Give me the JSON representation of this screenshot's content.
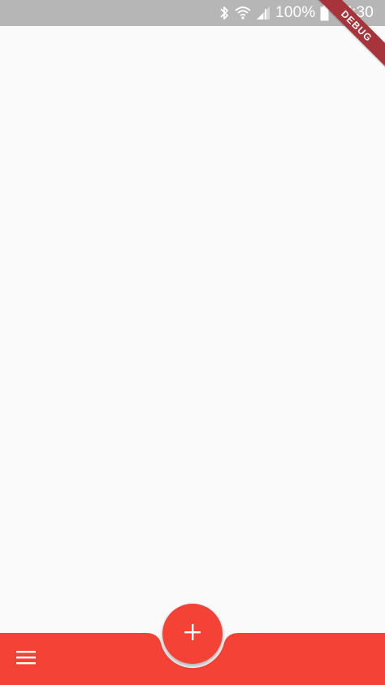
{
  "status_bar": {
    "battery_text": "100%",
    "time": "17:30",
    "icons": [
      "bluetooth-icon",
      "wifi-icon",
      "signal-icon",
      "battery-icon"
    ]
  },
  "debug_banner": {
    "label": "DEBUG",
    "color": "#a6343a"
  },
  "bottom_app_bar": {
    "color": "#f44336",
    "menu_icon": "menu-icon"
  },
  "fab": {
    "icon": "add-icon",
    "color": "#f44336"
  },
  "colors": {
    "status_bar": "#b6b6b6",
    "background": "#fafafa",
    "accent": "#f44336"
  }
}
